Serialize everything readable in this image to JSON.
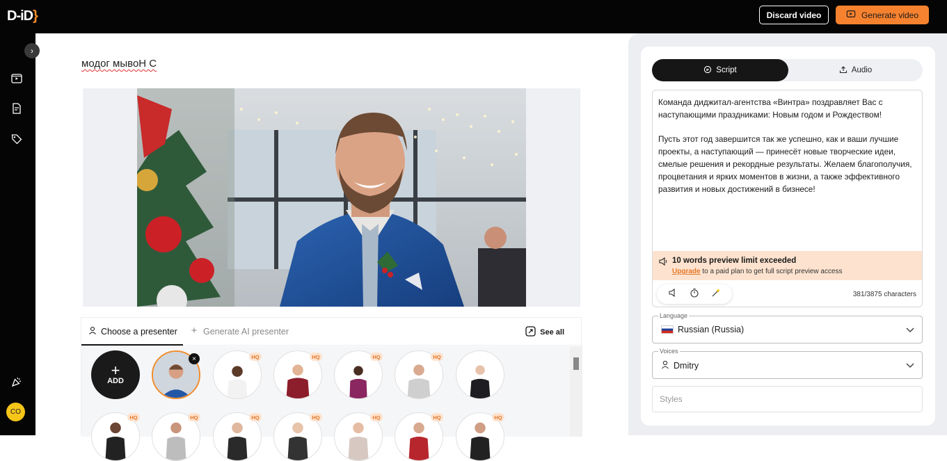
{
  "header": {
    "logo": "D-iD",
    "discard_label": "Discard video",
    "generate_label": "Generate video"
  },
  "sidebar": {
    "items": [
      {
        "icon": "video-library-icon"
      },
      {
        "icon": "document-icon"
      },
      {
        "icon": "tag-icon"
      },
      {
        "icon": "party-popper-icon"
      }
    ],
    "user_initials": "CO"
  },
  "main": {
    "video_title": "модог мывоН С"
  },
  "presenters": {
    "tabs": [
      {
        "label": "Choose a presenter"
      },
      {
        "label": "Generate AI presenter"
      }
    ],
    "see_all_label": "See all",
    "add_label": "ADD",
    "hq_badge": "HQ"
  },
  "right_panel": {
    "tabs": {
      "script": "Script",
      "audio": "Audio"
    },
    "script_paragraphs": [
      "Команда диджитал-агентства «Винтра» поздравляет Вас с наступающими праздниками: Новым годом и Рождеством!",
      "Пусть этот год завершится так же успешно, как и ваши лучшие проекты, а наступающий — принесёт новые творческие идеи, смелые решения и рекордные результаты. Желаем благополучия, процветания и ярких моментов в жизни, а также эффективного развития и новых достижений в бизнесе!"
    ],
    "limit_title": "10 words preview limit exceeded",
    "limit_upgrade": "Upgrade",
    "limit_rest": " to a paid plan to get full script preview access",
    "char_count": "381/3875 characters",
    "language": {
      "label": "Language",
      "value": "Russian (Russia)"
    },
    "voices": {
      "label": "Voices",
      "value": "Dmitry"
    },
    "styles": {
      "placeholder": "Styles"
    },
    "accent_color": "#f6822f"
  }
}
